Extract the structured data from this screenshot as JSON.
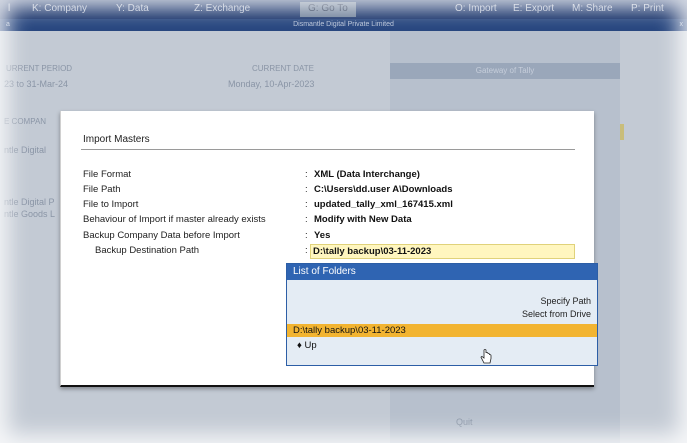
{
  "topbar": {
    "menus": [
      {
        "name": "menu-company",
        "label": "K: Company"
      },
      {
        "name": "menu-data",
        "label": "Y: Data"
      },
      {
        "name": "menu-exchange",
        "label": "Z: Exchange"
      },
      {
        "name": "menu-goto",
        "label": "G: Go To"
      },
      {
        "name": "menu-import",
        "label": "O: Import"
      },
      {
        "name": "menu-export",
        "label": "E: Export"
      },
      {
        "name": "menu-share",
        "label": "M: Share"
      },
      {
        "name": "menu-print",
        "label": "P: Print"
      }
    ],
    "left_edge": "l"
  },
  "company_bar": {
    "title": "Dismantle Digital Private Limited",
    "left_edge": "a",
    "right_edge": "x"
  },
  "background": {
    "current_period_label": "URRENT PERIOD",
    "current_period": "23 to 31-Mar-24",
    "current_date_label": "CURRENT DATE",
    "current_date": "Monday, 10-Apr-2023",
    "company_label": "E COMPAN",
    "company_1": "ntle Digital",
    "company_2": "ntle Digital P",
    "company_3": "ntle Goods L",
    "gateway_header": "Gateway of Tally",
    "gateway_bottom": "Quit"
  },
  "modal": {
    "title": "Import Masters",
    "fields": [
      {
        "label": "File Format",
        "value": "XML (Data Interchange)"
      },
      {
        "label": "File Path",
        "value": "C:\\Users\\dd.user A\\Downloads"
      },
      {
        "label": "File to Import",
        "value": "updated_tally_xml_167415.xml"
      },
      {
        "label": "Behaviour of Import if master already exists",
        "value": "Modify with New Data"
      },
      {
        "label": "Backup Company Data before Import",
        "value": "Yes"
      }
    ],
    "destination": {
      "label": "Backup Destination Path",
      "value": "D:\\tally backup\\03-11-2023"
    }
  },
  "folders_popup": {
    "title": "List of Folders",
    "actions": [
      "Specify Path",
      "Select from Drive"
    ],
    "selected": "D:\\tally backup\\03-11-2023",
    "up": "♦ Up"
  },
  "colors": {
    "topbar": "#17326a",
    "popup_title": "#2f64b2",
    "selection": "#f2b431",
    "input_highlight": "#fff6bf"
  }
}
